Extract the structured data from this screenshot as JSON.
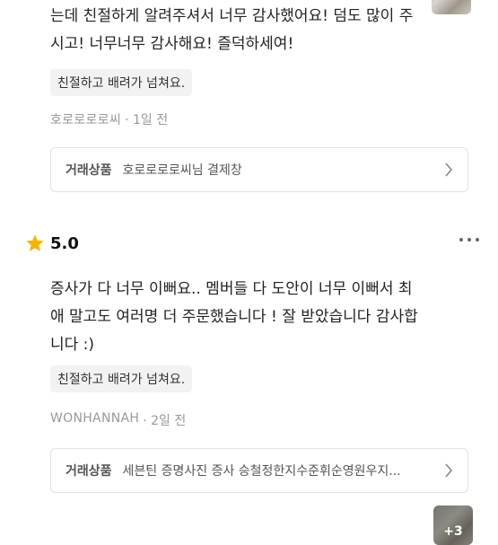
{
  "reviews": [
    {
      "text": "는데 친절하게 알려주셔서 너무 감사했어요! 덤도 많이 주시고! 너무너무 감사해요! 즐덕하세여!",
      "tag": "친절하고 배려가 넘쳐요.",
      "author": "호로로로로씨",
      "time": "· 1일 전",
      "product_label": "거래상품",
      "product_name": "호로로로로씨님 결제창"
    },
    {
      "rating": "5.0",
      "text": "증사가 다 너무 이뻐요.. 멤버들 다 도안이 너무 이뻐서 최애 말고도 여러명 더 주문했습니다 ! 잘 받았습니다 감사합니다 :)",
      "photo_more": "+3",
      "tag": "친절하고 배려가 넘쳐요.",
      "author": "WONHANNAH",
      "time": "· 2일 전",
      "product_label": "거래상품",
      "product_name": "세븐틴 증명사진 증사 승철정한지수준휘순영원우지..."
    }
  ],
  "colors": {
    "star": "#f5b400",
    "muted": "#999999",
    "tag_bg": "#f2f2f2",
    "border": "#e3e3e3"
  },
  "icons": {
    "rating": "star-icon",
    "more": "more-dots-icon",
    "product": "chevron-right-icon"
  }
}
